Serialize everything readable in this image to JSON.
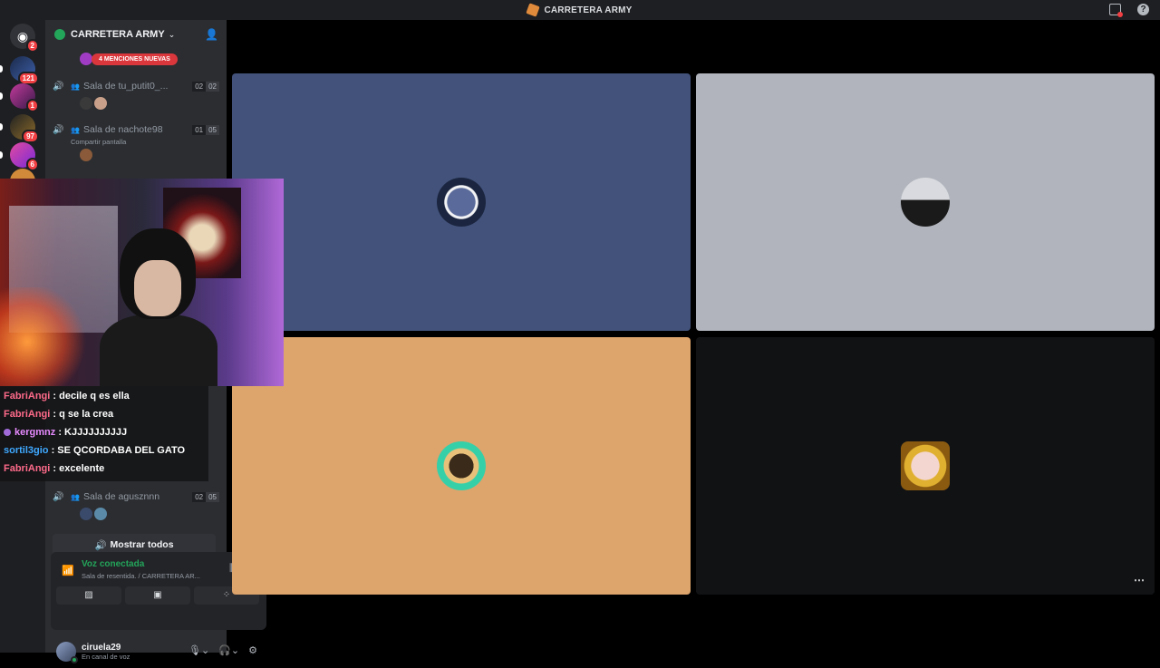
{
  "window": {
    "title": "CARRETERA ARMY"
  },
  "rail": {
    "home_badge": "2",
    "servers": [
      {
        "badge": "121"
      },
      {
        "badge": "1"
      },
      {
        "badge": "97"
      },
      {
        "badge": "6"
      }
    ]
  },
  "server": {
    "name": "CARRETERA ARMY",
    "mentions_pill": "4 MENCIONES NUEVAS"
  },
  "voice_channels": [
    {
      "name": "Sala de tu_putit0_...",
      "count_a": "02",
      "count_b": "02",
      "sub": ""
    },
    {
      "name": "Sala de nachote98",
      "count_a": "01",
      "count_b": "05",
      "sub": "Compartir pantalla"
    },
    {
      "name": "Sala de aguszn nn",
      "count_a": "02",
      "count_b": "05",
      "sub": ""
    }
  ],
  "voice_channel_3_name": "Sala de agusznnn",
  "show_all": "Mostrar todos",
  "voice_panel": {
    "status": "Voz conectada",
    "channel": "Sala de resentida. / CARRETERA AR..."
  },
  "user": {
    "name": "ciruela29",
    "status": "En canal de voz"
  },
  "chat": [
    {
      "user": "FabriAngi",
      "color": "#ff6b8a",
      "text": ": decile q es ella"
    },
    {
      "user": "FabriAngi",
      "color": "#ff6b8a",
      "text": ": q se la crea"
    },
    {
      "user": "kergmnz",
      "color": "#e78bff",
      "text": ": KJJJJJJJJJJ"
    },
    {
      "user": "sortil3gio",
      "color": "#3fa9ff",
      "text": ": SE QCORDABA DEL GATO"
    },
    {
      "user": "FabriAngi",
      "color": "#ff6b8a",
      "text": ": excelente"
    }
  ],
  "colors": {
    "tile_1": "#42527a",
    "tile_2": "#b1b4bc",
    "tile_3": "#dda46c",
    "tile_4": "#111214",
    "online": "#23a55a"
  },
  "icons": [
    "discord-icon",
    "speaker-icon",
    "invite-icon",
    "mic-icon",
    "headphones-icon",
    "gear-icon",
    "hangup-icon",
    "screen-share-icon",
    "camera-off-icon",
    "more-icon"
  ]
}
